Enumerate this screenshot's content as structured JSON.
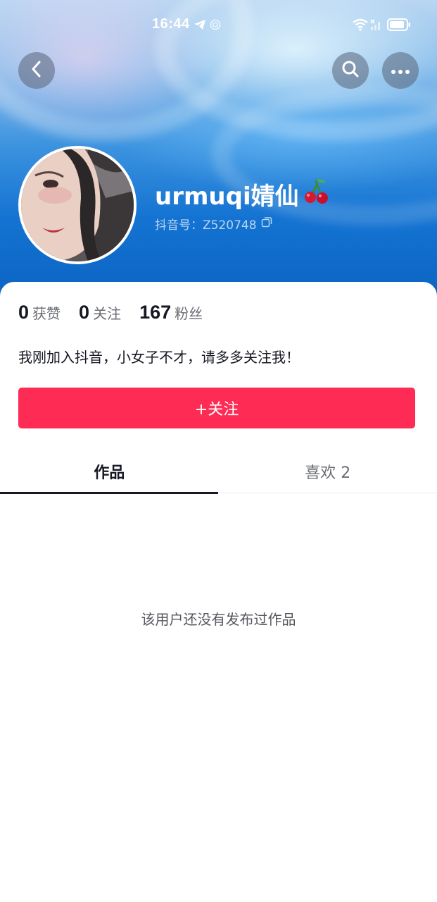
{
  "status_bar": {
    "time": "16:44",
    "icons": [
      "telegram-icon",
      "location-icon",
      "wifi-icon",
      "signal-icon",
      "battery-icon"
    ]
  },
  "header": {
    "back_icon": "chevron-left-icon",
    "search_icon": "search-icon",
    "more_icon": "more-horizontal-icon"
  },
  "profile": {
    "nickname": "urmuqi婧仙",
    "nickname_emoji": "🍒",
    "douyin_id": "抖音号：Z520748",
    "copy_icon": "copy-icon"
  },
  "stats": [
    {
      "value": "0",
      "label": "获赞"
    },
    {
      "value": "0",
      "label": "关注"
    },
    {
      "value": "167",
      "label": "粉丝"
    }
  ],
  "bio": "我刚加入抖音，小女子不才，请多多关注我！",
  "follow_button": {
    "label": "+关注"
  },
  "tabs": [
    {
      "label": "作品",
      "active": true
    },
    {
      "label": "喜欢 2",
      "active": false
    }
  ],
  "empty_state": "该用户还没有发布过作品",
  "colors": {
    "accent": "#fe2c55",
    "hero_top": "#b9d6f2",
    "hero_bottom": "#0b63c2"
  }
}
